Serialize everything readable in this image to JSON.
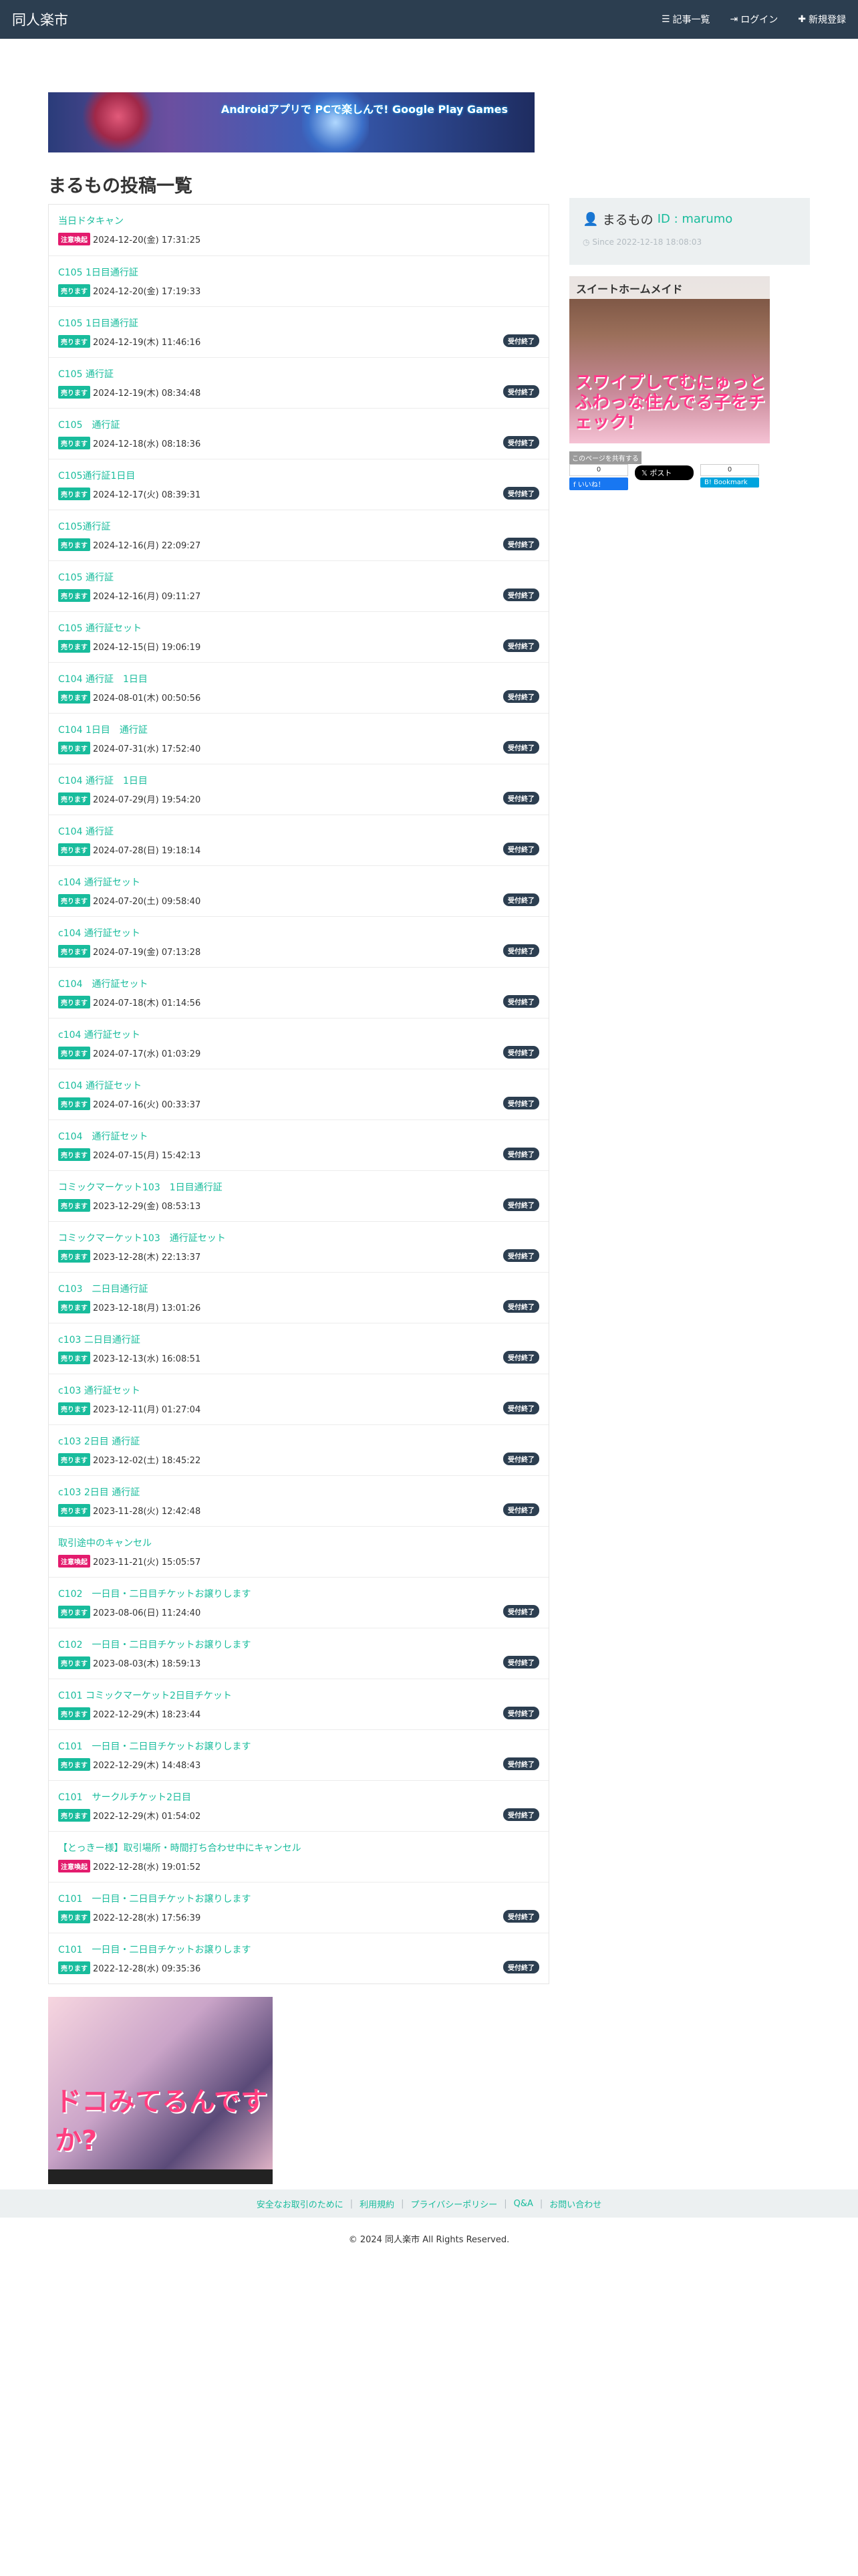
{
  "nav": {
    "brand": "同人楽市",
    "links": [
      {
        "icon": "list-icon",
        "glyph": "☰",
        "label": "記事一覧"
      },
      {
        "icon": "login-icon",
        "glyph": "⇥",
        "label": "ログイン"
      },
      {
        "icon": "plus-icon",
        "glyph": "✚",
        "label": "新規登録"
      }
    ]
  },
  "banner_ad": {
    "text": "Androidアプリで PCで楽しんで! Google Play Games"
  },
  "page_title": "まるもの投稿一覧",
  "posts": [
    {
      "title": "当日ドタキャン",
      "tag": "注意喚起",
      "tag_type": "notice",
      "date": "2024-12-20(金) 17:31:25",
      "status": ""
    },
    {
      "title": "C105 1日目通行証",
      "tag": "売ります",
      "tag_type": "sell",
      "date": "2024-12-20(金) 17:19:33",
      "status": ""
    },
    {
      "title": "C105 1日目通行証",
      "tag": "売ります",
      "tag_type": "sell",
      "date": "2024-12-19(木) 11:46:16",
      "status": "受付終了"
    },
    {
      "title": "C105 通行証",
      "tag": "売ります",
      "tag_type": "sell",
      "date": "2024-12-19(木) 08:34:48",
      "status": "受付終了"
    },
    {
      "title": "C105　通行証",
      "tag": "売ります",
      "tag_type": "sell",
      "date": "2024-12-18(水) 08:18:36",
      "status": "受付終了"
    },
    {
      "title": "C105通行証1日目",
      "tag": "売ります",
      "tag_type": "sell",
      "date": "2024-12-17(火) 08:39:31",
      "status": "受付終了"
    },
    {
      "title": "C105通行証",
      "tag": "売ります",
      "tag_type": "sell",
      "date": "2024-12-16(月) 22:09:27",
      "status": "受付終了"
    },
    {
      "title": "C105 通行証",
      "tag": "売ります",
      "tag_type": "sell",
      "date": "2024-12-16(月) 09:11:27",
      "status": "受付終了"
    },
    {
      "title": "C105 通行証セット",
      "tag": "売ります",
      "tag_type": "sell",
      "date": "2024-12-15(日) 19:06:19",
      "status": "受付終了"
    },
    {
      "title": "C104 通行証　1日目",
      "tag": "売ります",
      "tag_type": "sell",
      "date": "2024-08-01(木) 00:50:56",
      "status": "受付終了"
    },
    {
      "title": "C104 1日目　通行証",
      "tag": "売ります",
      "tag_type": "sell",
      "date": "2024-07-31(水) 17:52:40",
      "status": "受付終了"
    },
    {
      "title": "C104 通行証　1日目",
      "tag": "売ります",
      "tag_type": "sell",
      "date": "2024-07-29(月) 19:54:20",
      "status": "受付終了"
    },
    {
      "title": "C104 通行証",
      "tag": "売ります",
      "tag_type": "sell",
      "date": "2024-07-28(日) 19:18:14",
      "status": "受付終了"
    },
    {
      "title": "c104 通行証セット",
      "tag": "売ります",
      "tag_type": "sell",
      "date": "2024-07-20(土) 09:58:40",
      "status": "受付終了"
    },
    {
      "title": "c104 通行証セット",
      "tag": "売ります",
      "tag_type": "sell",
      "date": "2024-07-19(金) 07:13:28",
      "status": "受付終了"
    },
    {
      "title": "C104　通行証セット",
      "tag": "売ります",
      "tag_type": "sell",
      "date": "2024-07-18(木) 01:14:56",
      "status": "受付終了"
    },
    {
      "title": "c104 通行証セット",
      "tag": "売ります",
      "tag_type": "sell",
      "date": "2024-07-17(水) 01:03:29",
      "status": "受付終了"
    },
    {
      "title": "C104 通行証セット",
      "tag": "売ります",
      "tag_type": "sell",
      "date": "2024-07-16(火) 00:33:37",
      "status": "受付終了"
    },
    {
      "title": "C104　通行証セット",
      "tag": "売ります",
      "tag_type": "sell",
      "date": "2024-07-15(月) 15:42:13",
      "status": "受付終了"
    },
    {
      "title": "コミックマーケット103　1日目通行証",
      "tag": "売ります",
      "tag_type": "sell",
      "date": "2023-12-29(金) 08:53:13",
      "status": "受付終了"
    },
    {
      "title": "コミックマーケット103　通行証セット",
      "tag": "売ります",
      "tag_type": "sell",
      "date": "2023-12-28(木) 22:13:37",
      "status": "受付終了"
    },
    {
      "title": "C103　二日目通行証",
      "tag": "売ります",
      "tag_type": "sell",
      "date": "2023-12-18(月) 13:01:26",
      "status": "受付終了"
    },
    {
      "title": "c103 二日目通行証",
      "tag": "売ります",
      "tag_type": "sell",
      "date": "2023-12-13(水) 16:08:51",
      "status": "受付終了"
    },
    {
      "title": "c103 通行証セット",
      "tag": "売ります",
      "tag_type": "sell",
      "date": "2023-12-11(月) 01:27:04",
      "status": "受付終了"
    },
    {
      "title": "c103 2日目 通行証",
      "tag": "売ります",
      "tag_type": "sell",
      "date": "2023-12-02(土) 18:45:22",
      "status": "受付終了"
    },
    {
      "title": "c103 2日目 通行証",
      "tag": "売ります",
      "tag_type": "sell",
      "date": "2023-11-28(火) 12:42:48",
      "status": "受付終了"
    },
    {
      "title": "取引途中のキャンセル",
      "tag": "注意喚起",
      "tag_type": "notice",
      "date": "2023-11-21(火) 15:05:57",
      "status": ""
    },
    {
      "title": "C102　一日目・二日目チケットお譲りします",
      "tag": "売ります",
      "tag_type": "sell",
      "date": "2023-08-06(日) 11:24:40",
      "status": "受付終了"
    },
    {
      "title": "C102　一日目・二日目チケットお譲りします",
      "tag": "売ります",
      "tag_type": "sell",
      "date": "2023-08-03(木) 18:59:13",
      "status": "受付終了"
    },
    {
      "title": "C101 コミックマーケット2日目チケット",
      "tag": "売ります",
      "tag_type": "sell",
      "date": "2022-12-29(木) 18:23:44",
      "status": "受付終了"
    },
    {
      "title": "C101　一日目・二日目チケットお譲りします",
      "tag": "売ります",
      "tag_type": "sell",
      "date": "2022-12-29(木) 14:48:43",
      "status": "受付終了"
    },
    {
      "title": "C101　サークルチケット2日目",
      "tag": "売ります",
      "tag_type": "sell",
      "date": "2022-12-29(木) 01:54:02",
      "status": "受付終了"
    },
    {
      "title": "【とっきー様】取引場所・時間打ち合わせ中にキャンセル",
      "tag": "注意喚起",
      "tag_type": "notice",
      "date": "2022-12-28(水) 19:01:52",
      "status": ""
    },
    {
      "title": "C101　一日目・二日目チケットお譲りします",
      "tag": "売ります",
      "tag_type": "sell",
      "date": "2022-12-28(水) 17:56:39",
      "status": "受付終了"
    },
    {
      "title": "C101　一日目・二日目チケットお譲りします",
      "tag": "売ります",
      "tag_type": "sell",
      "date": "2022-12-28(水) 09:35:36",
      "status": "受付終了"
    }
  ],
  "bottom_ad": {
    "text": "ドコみてるんですか?"
  },
  "profile": {
    "name": "まるもの",
    "id_label": "ID : marumo",
    "since": "Since 2022-12-18 18:08:03"
  },
  "side_ad": {
    "header": "スイートホームメイド",
    "text": "スワイプしてむにゅっとふわっな住んでる子をチェック!"
  },
  "share": {
    "label": "このページを共有する",
    "fb_count": "0",
    "fb_label": "いいね！",
    "x_label": "ポスト",
    "hb_count": "0",
    "hb_label": "Bookmark"
  },
  "footer": {
    "links": [
      "安全なお取引のために",
      "利用規約",
      "プライバシーポリシー",
      "Q&A",
      "お問い合わせ"
    ],
    "copyright": "© 2024 同人楽市 All Rights Reserved."
  }
}
